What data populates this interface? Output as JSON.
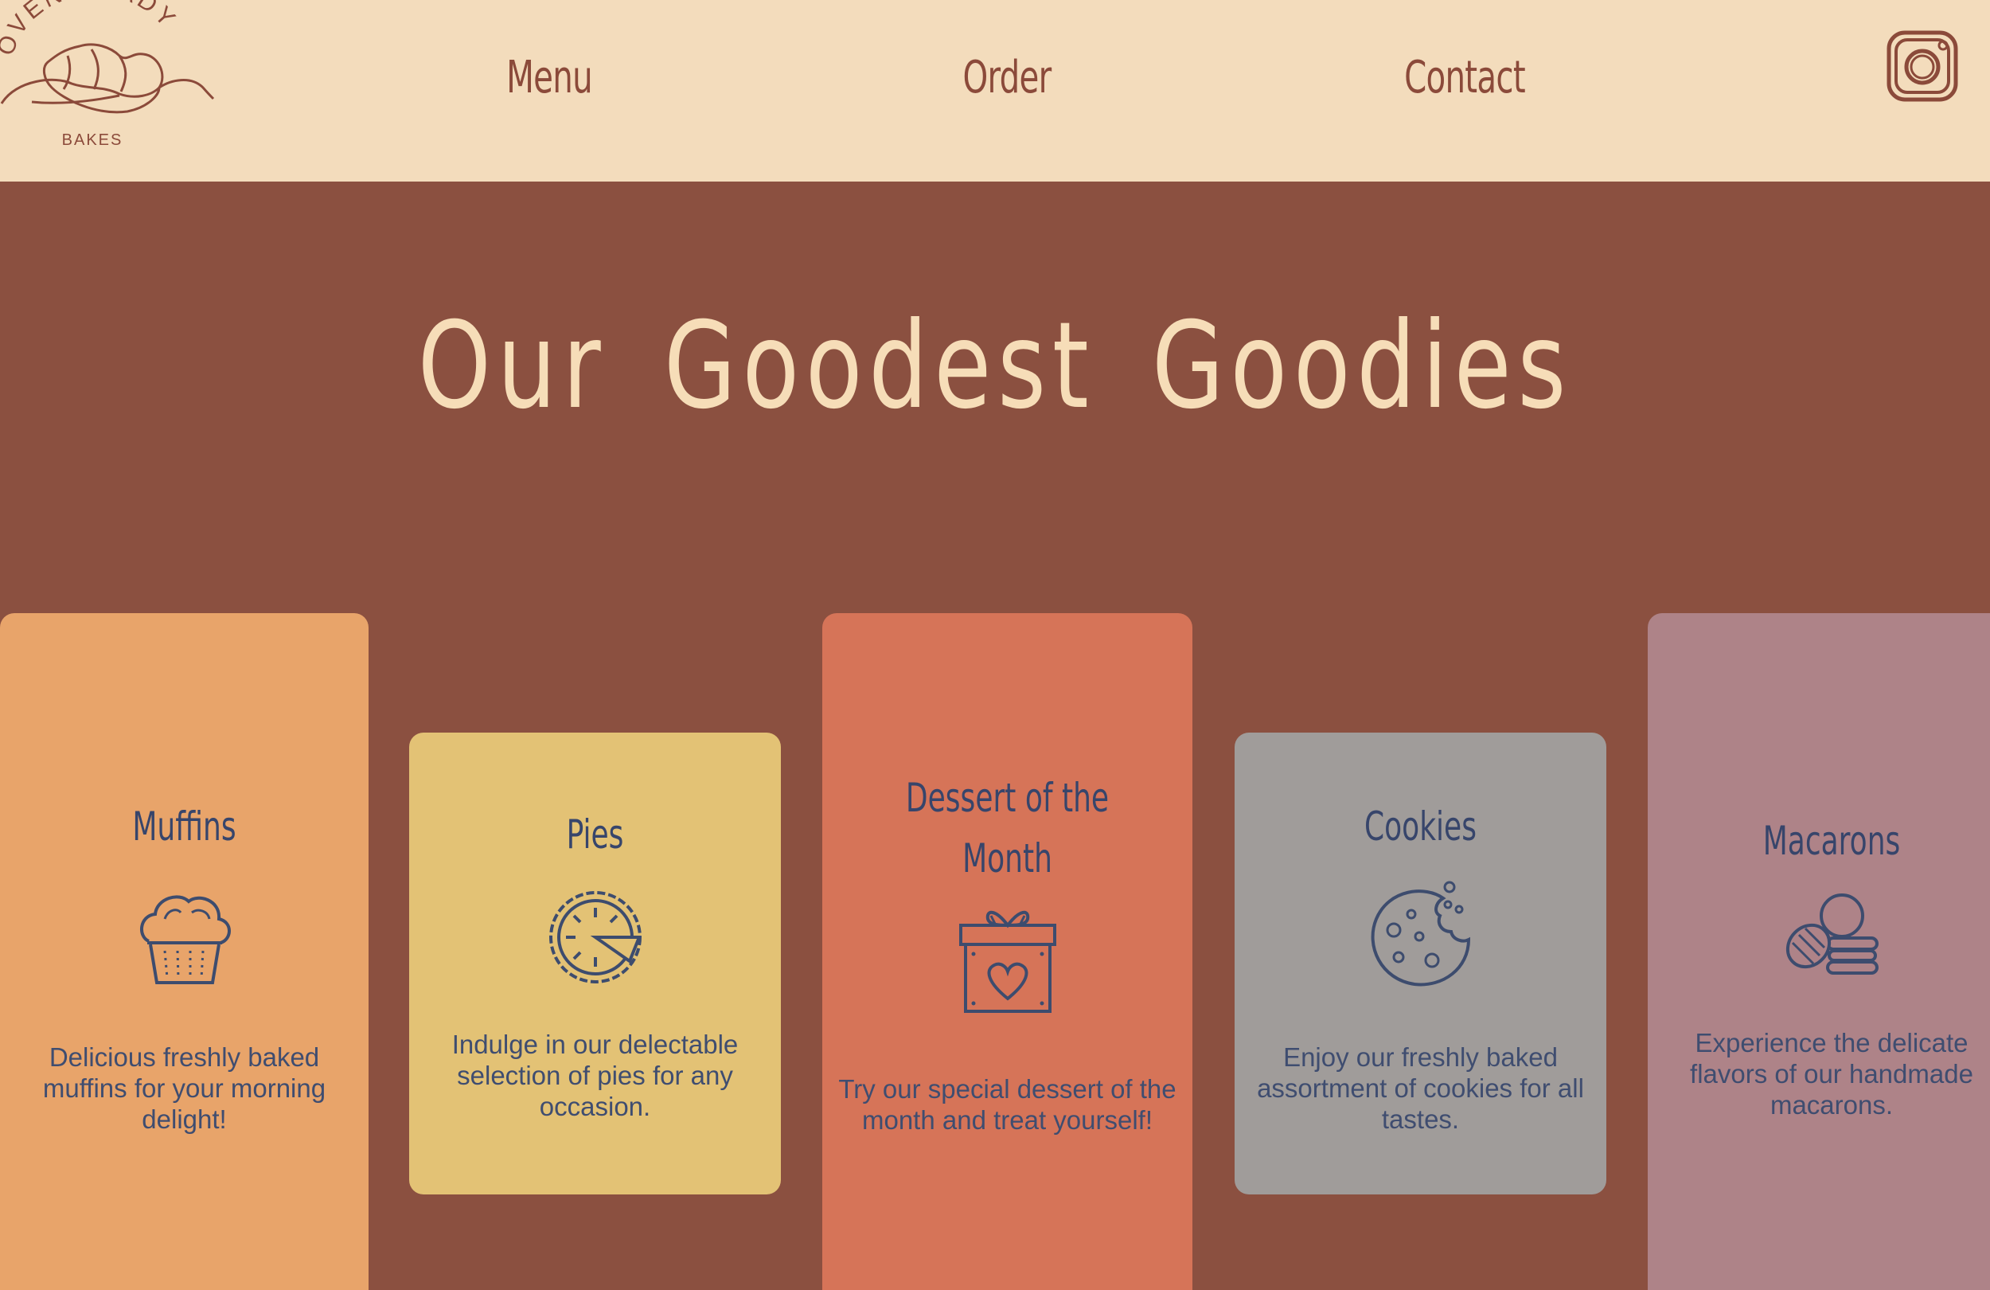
{
  "brand": {
    "arc_text": "OVEN READY",
    "sub_text": "BAKES"
  },
  "nav": {
    "menu": "Menu",
    "order": "Order",
    "contact": "Contact"
  },
  "social": {
    "icon": "instagram-icon"
  },
  "hero": {
    "title": "Our Goodest Goodies"
  },
  "cards": [
    {
      "title": "Muffins",
      "icon": "muffin-icon",
      "description": "Delicious freshly baked muffins for your morning delight!",
      "color": "#E8A46A"
    },
    {
      "title": "Pies",
      "icon": "pie-icon",
      "description": "Indulge in our delectable selection of pies for any occasion.",
      "color": "#E3C275"
    },
    {
      "title": "Dessert of the Month",
      "icon": "gift-heart-icon",
      "description": "Try our special dessert of the month and treat yourself!",
      "color": "#D67458"
    },
    {
      "title": "Cookies",
      "icon": "cookie-icon",
      "description": "Enjoy our freshly baked assortment of cookies for all tastes.",
      "color": "#A09C9A"
    },
    {
      "title": "Macarons",
      "icon": "macarons-icon",
      "description": "Experience the delicate flavors of our handmade macarons.",
      "color": "#AE8388"
    }
  ],
  "colors": {
    "header_bg": "#F3DCBC",
    "hero_bg": "#8B5040",
    "nav_text": "#8B4A3A",
    "card_text": "#3D4C6E"
  }
}
